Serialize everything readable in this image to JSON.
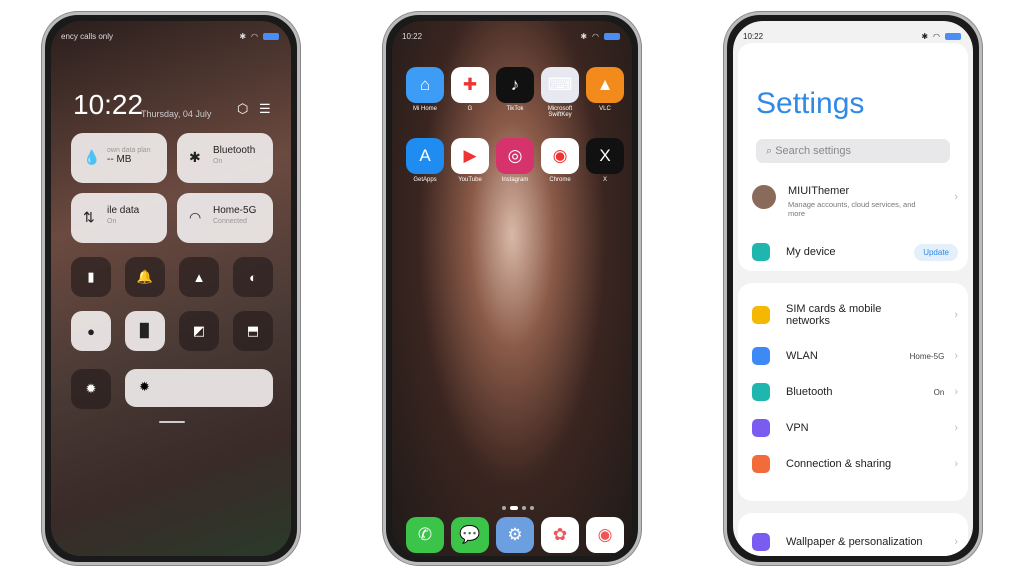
{
  "control_center": {
    "status_left": "ency calls only",
    "time": "10:22",
    "date": "Thursday, 04 July",
    "tiles": [
      {
        "title": "own data plan",
        "sub": "-- MB"
      },
      {
        "title": "Bluetooth",
        "sub": "On"
      },
      {
        "title": "ile data",
        "sub": "On"
      },
      {
        "title": "Home-5G",
        "sub": "Connected"
      }
    ]
  },
  "home": {
    "time": "10:22",
    "apps": [
      "Mi Home",
      "G",
      "TikTok",
      "Microsoft SwiftKey",
      "VLC",
      "GetApps",
      "YouTube",
      "Instagram",
      "Chrome",
      "X"
    ],
    "dock": [
      "Phone",
      "Messages",
      "Settings",
      "Gallery",
      "Camera"
    ]
  },
  "settings": {
    "time": "10:22",
    "title": "Settings",
    "search_placeholder": "Search settings",
    "account": {
      "name": "MIUIThemer",
      "desc": "Manage accounts, cloud services, and more"
    },
    "device": {
      "label": "My device",
      "badge": "Update"
    },
    "items": [
      {
        "label": "SIM cards & mobile networks",
        "value": "",
        "color": "#f5b800"
      },
      {
        "label": "WLAN",
        "value": "Home-5G",
        "color": "#3d8af7"
      },
      {
        "label": "Bluetooth",
        "value": "On",
        "color": "#1fb6b0"
      },
      {
        "label": "VPN",
        "value": "",
        "color": "#7a5cf0"
      },
      {
        "label": "Connection & sharing",
        "value": "",
        "color": "#f26b3a"
      }
    ],
    "bottom_item": {
      "label": "Wallpaper & personalization",
      "color": "#7a5cf0"
    },
    "accent": "#2f8ae6"
  }
}
